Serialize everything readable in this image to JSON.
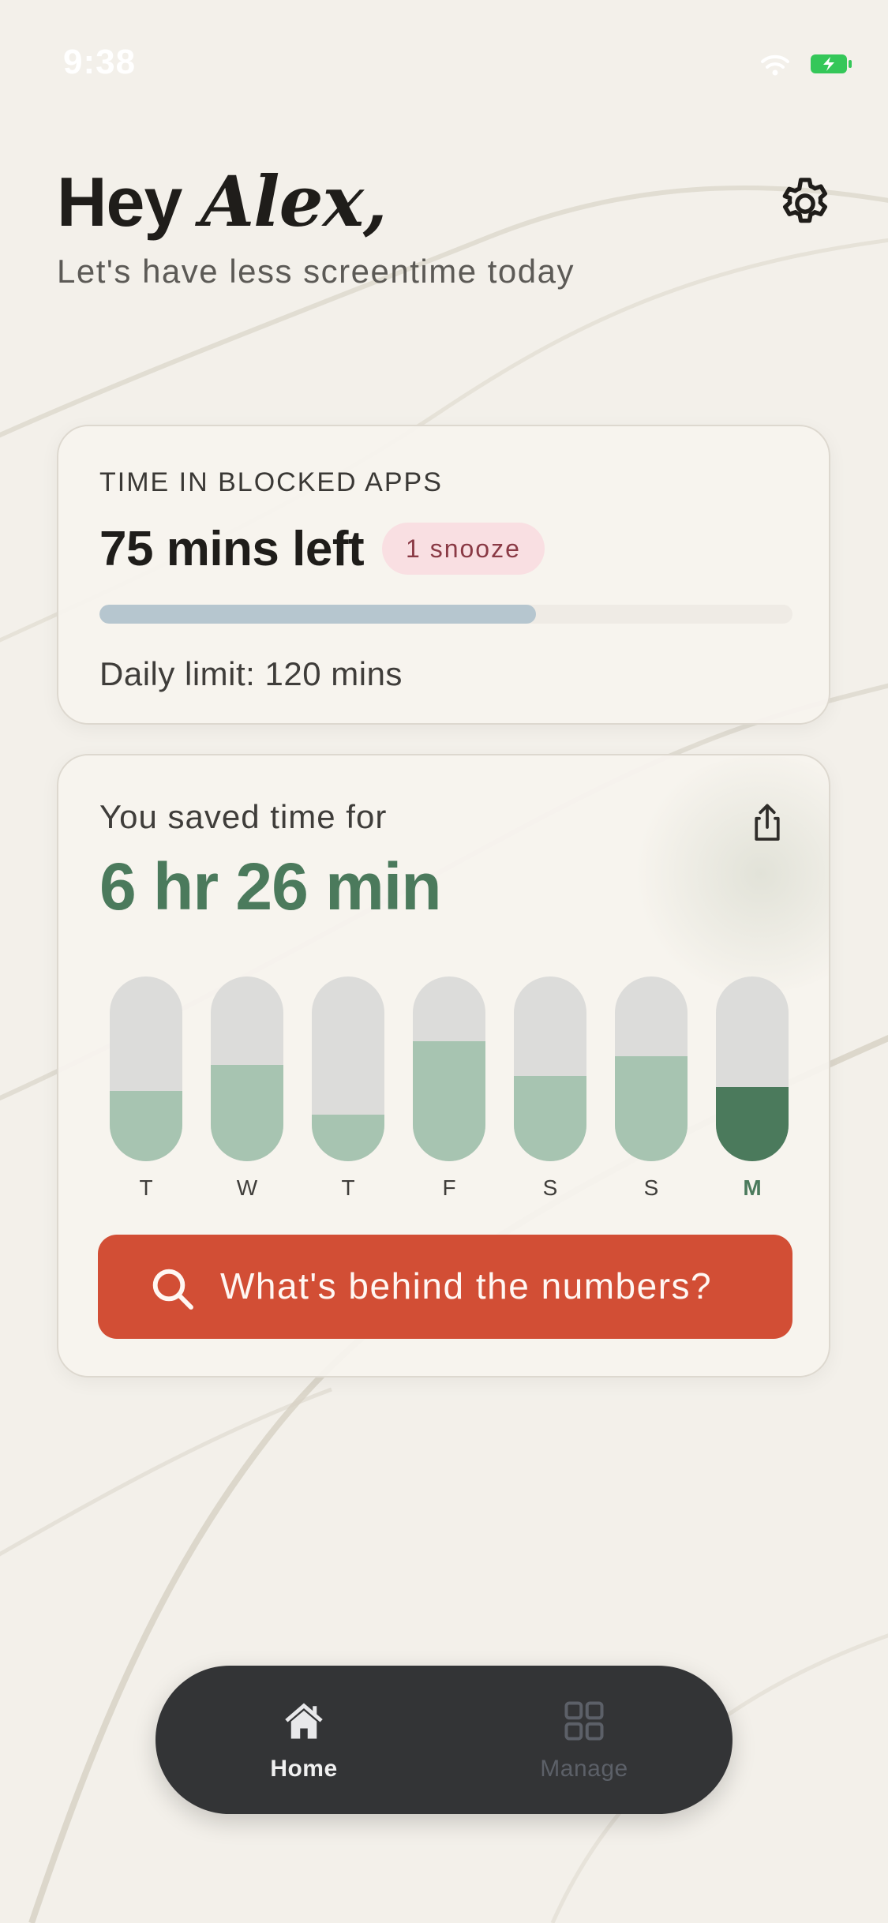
{
  "status_bar": {
    "time": "9:38",
    "wifi_icon": "wifi-icon",
    "battery_icon": "battery-charging-icon",
    "battery_color": "#34c759"
  },
  "header": {
    "greeting_prefix": "Hey",
    "user_name": "Alex,",
    "subtitle": "Let's have less screentime today",
    "settings_icon": "gear-icon"
  },
  "limit_card": {
    "heading": "TIME IN BLOCKED APPS",
    "remaining": "75 mins left",
    "snooze_badge": "1 snooze",
    "progress_fraction": 0.63,
    "daily_limit": "Daily limit: 120 mins"
  },
  "saved_card": {
    "label": "You saved time for",
    "value": "6 hr 26 min",
    "share_icon": "share-icon",
    "days": [
      {
        "label": "T",
        "fill": 0.38,
        "current": false
      },
      {
        "label": "W",
        "fill": 0.52,
        "current": false
      },
      {
        "label": "T",
        "fill": 0.25,
        "current": false
      },
      {
        "label": "F",
        "fill": 0.65,
        "current": false
      },
      {
        "label": "S",
        "fill": 0.46,
        "current": false
      },
      {
        "label": "S",
        "fill": 0.57,
        "current": false
      },
      {
        "label": "M",
        "fill": 0.4,
        "current": true
      }
    ],
    "cta_label": "What's behind the numbers?",
    "cta_icon": "search-icon"
  },
  "tab_bar": {
    "home_label": "Home",
    "home_icon": "home-icon",
    "manage_label": "Manage",
    "manage_icon": "grid-icon"
  },
  "colors": {
    "accent_green": "#4b7a5c",
    "light_green": "#a7c4b1",
    "cta_red": "#d24e35",
    "snooze_pink": "#f9dfe2",
    "progress_blue": "#b6c6cf",
    "tab_bar_bg": "#333436"
  }
}
